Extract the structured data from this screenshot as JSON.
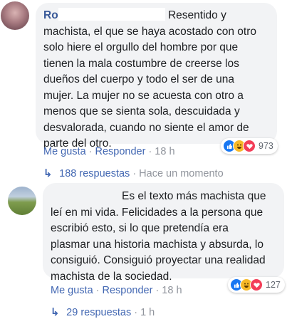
{
  "comments": [
    {
      "author": "Ro",
      "text_line1_tail": "Resentido y",
      "text_rest": "machista, el que se haya acostado con otro\nsolo hiere el orgullo del hombre por que\ntienen la mala costumbre de creerse los\ndueños del cuerpo y todo el ser de una\nmujer. La mujer no se acuesta con otro a\nmenos que se sienta sola, descuidada y\ndesvalorada, cuando no siente el amor de\nparte del otro.",
      "like_label": "Me gusta",
      "reply_label": "Responder",
      "time": "18 h",
      "reaction_count": "973",
      "reaction_icons": [
        "like-icon",
        "haha-icon",
        "love-icon"
      ],
      "replies_label": "188 respuestas",
      "replies_time": "Hace un momento"
    },
    {
      "text": "Es el texto más machista que\nleí en mi vida. Felicidades a la persona que\nescribió esto, si lo que pretendía era\nplasmar una historia machista y absurda, lo\nconsiguió. Consiguió proyectar una realidad\nmachista de la sociedad.",
      "like_label": "Me gusta",
      "reply_label": "Responder",
      "time": "18 h",
      "reaction_count": "127",
      "reaction_icons": [
        "like-icon",
        "haha-icon",
        "love-icon"
      ],
      "replies_label": "29 respuestas",
      "replies_time": "1 h"
    }
  ],
  "separator": "·",
  "reply_arrow": "↳",
  "colors": {
    "link": "#4267b2",
    "author": "#385898",
    "muted": "#90949c",
    "bubble": "#f2f3f5"
  }
}
